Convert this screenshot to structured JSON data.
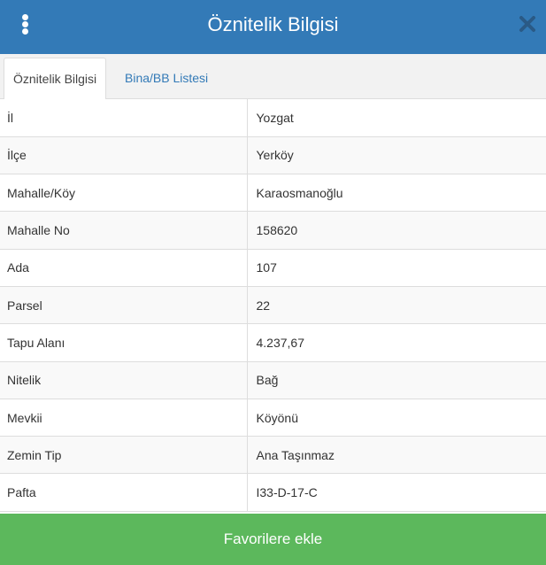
{
  "header": {
    "title": "Öznitelik Bilgisi",
    "menu_icon": "vertical-ellipsis-icon",
    "close_icon": "close-icon",
    "color": "#337ab7"
  },
  "tabs": [
    {
      "label": "Öznitelik Bilgisi",
      "active": true
    },
    {
      "label": "Bina/BB Listesi",
      "active": false
    }
  ],
  "attributes": [
    {
      "key": "İl",
      "value": "Yozgat"
    },
    {
      "key": "İlçe",
      "value": "Yerköy"
    },
    {
      "key": "Mahalle/Köy",
      "value": "Karaosmanoğlu"
    },
    {
      "key": "Mahalle No",
      "value": "158620"
    },
    {
      "key": "Ada",
      "value": "107"
    },
    {
      "key": "Parsel",
      "value": "22"
    },
    {
      "key": "Tapu Alanı",
      "value": "4.237,67"
    },
    {
      "key": "Nitelik",
      "value": "Bağ"
    },
    {
      "key": "Mevkii",
      "value": "Köyönü"
    },
    {
      "key": "Zemin Tip",
      "value": "Ana Taşınmaz"
    },
    {
      "key": "Pafta",
      "value": "I33-D-17-C"
    }
  ],
  "footer": {
    "button_label": "Favorilere ekle",
    "color": "#5cb85c"
  }
}
